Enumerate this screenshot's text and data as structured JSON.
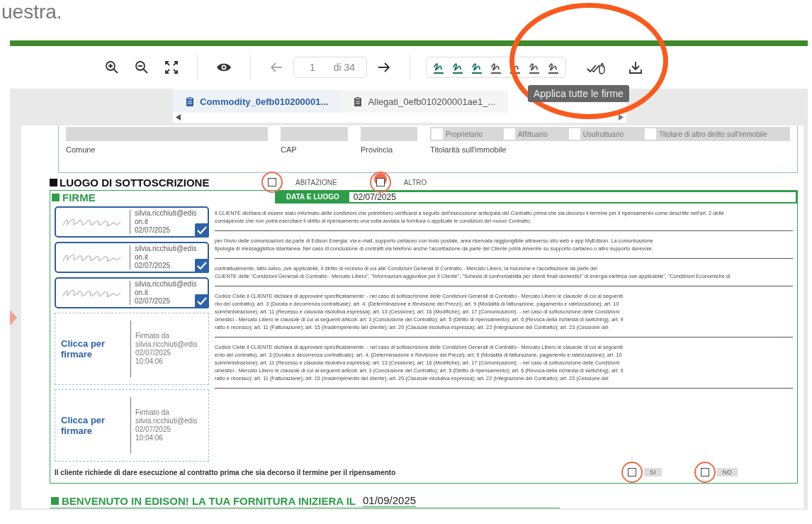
{
  "heading_fragment": "uestra.",
  "toolbar": {
    "page_value": "1",
    "page_total": "di 34",
    "highlighted": true,
    "tooltip": "Applica tutte le firme",
    "signatures": [
      {
        "applied": true
      },
      {
        "applied": true
      },
      {
        "applied": true
      },
      {
        "applied": false
      },
      {
        "applied": false
      },
      {
        "applied": false
      },
      {
        "applied": false
      }
    ]
  },
  "tabs": [
    {
      "label": "Commodity_0efb010200001...",
      "selected": true
    },
    {
      "label": "Allegati_0efb010200001ae1_...",
      "selected": false
    }
  ],
  "address": {
    "fields": [
      {
        "label": "Comune"
      },
      {
        "label": "CAP"
      },
      {
        "label": "Provincia"
      }
    ],
    "ownership_label": "Titolarità sull'immobile",
    "ownership_options": [
      {
        "label": "Proprietario",
        "checked": false
      },
      {
        "label": "Affittuario",
        "checked": false
      },
      {
        "label": "Usufruttuario",
        "checked": false
      },
      {
        "label": "Titolare di altro diritto sull'immobile",
        "checked": false
      }
    ]
  },
  "luogo": {
    "title": "LUOGO DI SOTTOSCRIZIONE",
    "options": [
      {
        "label": "ABITAZIONE",
        "checked": false,
        "highlighted": true,
        "clicked": false
      },
      {
        "label": "ALTRO",
        "checked": false,
        "highlighted": true,
        "clicked": true
      }
    ]
  },
  "firme": {
    "title": "FIRME",
    "date_label": "DATA E LUOGO",
    "date": "02/07/2025"
  },
  "stamps": [
    {
      "kind": "signed",
      "email": "silvia.ricchiuti@edison.it",
      "date": "02/07/2025"
    },
    {
      "kind": "signed",
      "email": "silvia.ricchiuti@edison.it",
      "date": "02/07/2025"
    },
    {
      "kind": "signed",
      "email": "silvia.ricchiuti@edison.it",
      "date": "02/07/2025"
    },
    {
      "kind": "pending",
      "action": "Clicca per firmare",
      "caption": "Firmato da",
      "email": "silvia.ricchiuti@edis",
      "date": "02/07/2025",
      "time": "10:04:06"
    },
    {
      "kind": "pending",
      "action": "Clicca per firmare",
      "caption": "Firmato da",
      "email": "silvia.ricchiuti@edis",
      "date": "02/07/2025",
      "time": "10:04:06"
    }
  ],
  "paragraphs": [
    {
      "lines": [
        "Il CLIENTE dichiara di essere stato informato delle condizioni che potrebbero verificarsi a seguito dell'esecuzione anticipata del Contratto prima che sia decorso il termine per il ripensamento come descritte nell'art. 2 delle",
        "consapevole che non potrà esercitare il diritto di ripensamento una volta avviata la fornitura o applicate le condizioni del nuovo Contratto."
      ]
    },
    {
      "lines": [
        "per l'invio delle comunicazioni da parte di Edison Energia: via e-mail, supporto cartaceo con invio postale, area riservata raggiungibile attraverso sito web o app MyEdison. La comunicazione",
        "tipologia di messaggistica istantanea. Nel caso di conclusione di contratti via telefono anche l'accettazione da parte del Cliente potrà avvenire su supporto cartaceo o altro supporto durevole."
      ]
    },
    {
      "lines": [
        "contrattualmente, fatto salvo, ove applicabile, il diritto di recesso di cui alle Condizioni Generali di Contratto - Mercato Libero; la ricezione e l'accettazione da parte del",
        "CLIENTE delle \"Condizioni Generali di Contratto - Mercato Libero\", \"Informazioni aggiuntive per il Cliente\", \"Scheda di confrontabilità per clienti finali domestici\" di energia elettrica ove applicabile\", \"Condizioni Economiche di"
      ]
    },
    {
      "lines": [
        "Codice Civile il CLIENTE dichiara di approvare specificatamente: - nel caso di sottoscrizione delle Condizioni Generali di Contratto - Mercato Libero le clausole di cui ai seguenti",
        "nto del contratto); art. 3 (Durata e decorrenza contrattuale); art. 4. (Determinazione e Revisione dei Prezzi); art. 9 (Modalità di fatturazione, pagamento e rateizzazione); art. 10",
        "somministrazione); art. 11 (Recesso e clausola risolutiva espressa); art. 13 (Cessione); art. 16 (Modifiche); art. 17 (Comunicazioni). - nel caso di sottoscrizione delle Condizioni",
        "omestici - Mercato Libero le clausole di cui ai seguenti articoli: art. 3 (Conclusione del Contratto); art. 5 (Diritto di ripensamento); art. 6 (Revoca della richiesta di switching); art. 9",
        "ratto e recesso); art. 11 (Fatturazione); art. 15 (Inadempimento del cliente); art. 20 (Clausole risolutiva espressa); art. 22 (Integrazione del Contratto); art. 23 (Cessione del"
      ]
    },
    {
      "lines": [
        "Codice Civile il CLIENTE dichiara di approvare specificatamente: - nel caso di sottoscrizione delle Condizioni Generali di Contratto - Mercato Libero le clausole di cui ai seguenti",
        "ento del contratto); art. 3 (Durata e decorrenza contrattuale); art. 4. (Determinazione e Revisione dei Prezzi); art. 9 (Modalità di fatturazione, pagamento e rateizzazione); art. 10",
        "somministrazione); art. 11 (Recesso e clausola risolutiva espressa); art. 13 (Cessione); art. 16 (Modifiche); art. 17 (Comunicazioni). - nel caso di sottoscrizione delle Condizioni",
        "omestici - Mercato Libero le clausole di cui ai seguenti articoli: art. 3 (Conclusione del Contratto); art. 5 (Diritto di ripensamento); art. 6 (Revoca della richiesta di switching); art. 9",
        "ratto e recesso); art. 11 (Fatturazione); art. 15 (Inadempimento del cliente); art. 20 (Clausole risolutiva espressa); art. 22 (Integrazione del Contratto); art. 23 (Cessione del"
      ]
    }
  ],
  "execution": {
    "text": "Il cliente richiede di dare esecuzione al contratto prima che sia decorso il termine per il ripensamento",
    "options": [
      {
        "label": "SI",
        "checked": false,
        "highlighted": true
      },
      {
        "label": "NO",
        "checked": false,
        "highlighted": true
      }
    ]
  },
  "welcome": {
    "title": "BENVENUTO IN EDISON! LA TUA FORNITURA INIZIERA IL",
    "date": "01/09/2025"
  }
}
